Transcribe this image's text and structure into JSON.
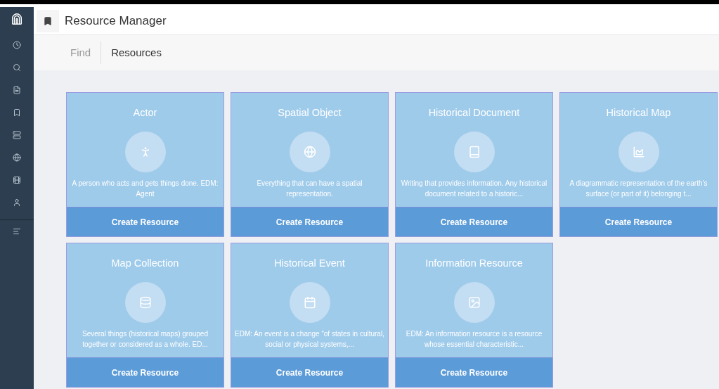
{
  "header": {
    "title": "Resource Manager"
  },
  "tabs": [
    {
      "label": "Find",
      "selected": false
    },
    {
      "label": "Resources",
      "selected": true
    }
  ],
  "cards": [
    {
      "title": "Actor",
      "description": "A person who acts and gets things done. EDM: Agent",
      "button": "Create Resource"
    },
    {
      "title": "Spatial Object",
      "description": "Everything that can have a spatial representation.",
      "button": "Create Resource"
    },
    {
      "title": "Historical Document",
      "description": "Writing that provides information. Any historical document related to a historic...",
      "button": "Create Resource"
    },
    {
      "title": "Historical Map",
      "description": "A diagrammatic representation of the earth's surface (or part of it) belonging t...",
      "button": "Create Resource"
    },
    {
      "title": "Map Collection",
      "description": "Several things (historical maps) grouped together or considered as a whole. ED...",
      "button": "Create Resource"
    },
    {
      "title": "Historical Event",
      "description": "EDM: An event is a change “of states in cultural, social or physical systems,...",
      "button": "Create Resource"
    },
    {
      "title": "Information Resource",
      "description": "EDM: An information resource is a resource whose essential characteristic...",
      "button": "Create Resource"
    }
  ]
}
